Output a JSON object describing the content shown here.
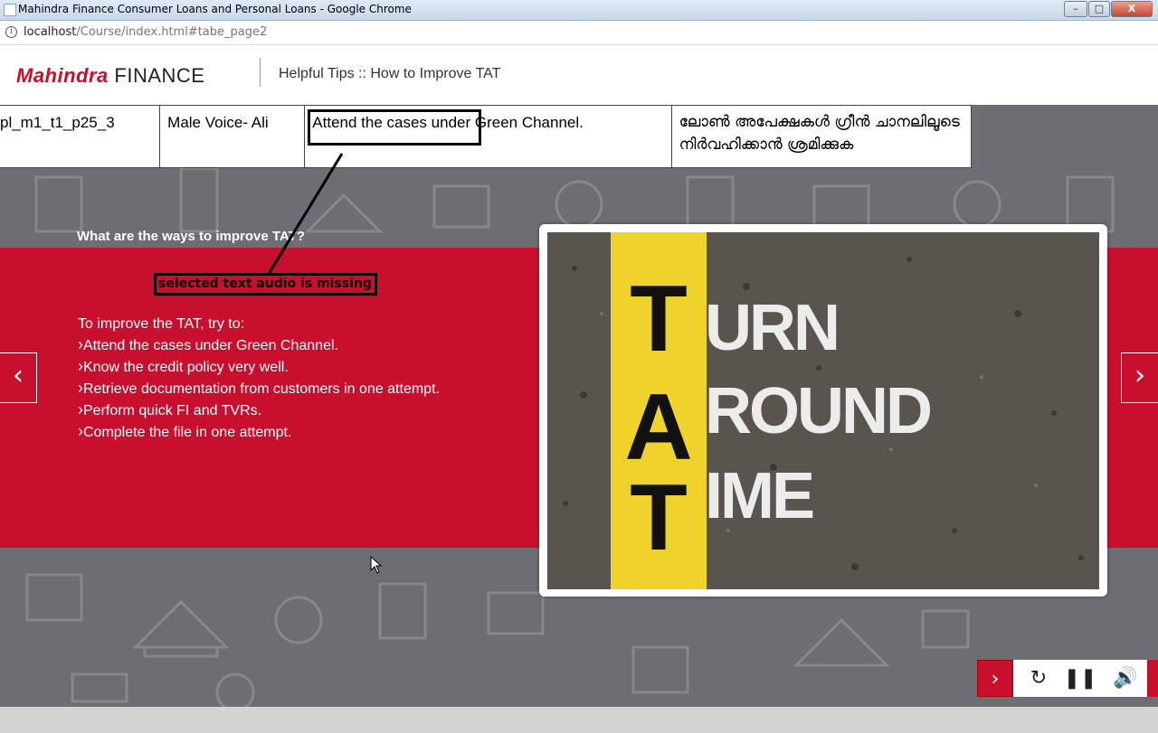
{
  "browser": {
    "window_title": "Mahindra Finance Consumer Loans and Personal Loans - Google Chrome",
    "url_host": "localhost",
    "url_path": "/Course/index.html#tabe_page2",
    "min_label": "–",
    "max_label": "□",
    "close_label": "X"
  },
  "header": {
    "logo_brand": "Mahindra",
    "logo_suffix": "FINANCE",
    "page_title": "Helpful Tips :: How to Improve TAT"
  },
  "review_table": {
    "screen_id": "pl_m1_t1_p25_3",
    "voice": "Male Voice- Ali",
    "english_text": "Attend the cases under Green Channel.",
    "malayalam_text": "ലോൺ അപേക്ഷകൾ ഗ്രീൻ ചാനലിലൂടെ നിർവഹിക്കാൻ ശ്രമിക്കുക"
  },
  "annotation": {
    "note": "selected text audio is missing"
  },
  "slide": {
    "question": "What are the ways to improve TAT?",
    "lead": "To improve the TAT, try to:",
    "tips": [
      "Attend the cases under Green Channel.",
      "Know the credit policy very well.",
      "Retrieve documentation from customers in one attempt.",
      "Perform quick FI and TVRs.",
      "Complete the file in one attempt."
    ],
    "image_letters": [
      "T",
      "A",
      "T"
    ],
    "image_words": [
      "URN",
      "ROUND",
      "IME"
    ]
  },
  "nav": {
    "prev_glyph": "‹",
    "next_glyph": "›"
  },
  "controls": {
    "next_glyph": "›",
    "reload_glyph": "↻",
    "pause_glyph": "❚❚",
    "volume_glyph": "🔊"
  },
  "colors": {
    "brand_red": "#c8102e",
    "stage_grey": "#6c6e73",
    "road_yellow": "#efd22a"
  }
}
